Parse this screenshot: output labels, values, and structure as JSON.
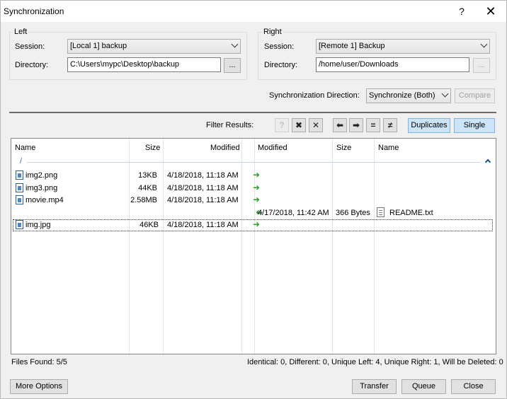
{
  "window": {
    "title": "Synchronization",
    "help_glyph": "?",
    "close_glyph": "✕"
  },
  "left": {
    "group_label": "Left",
    "session_label": "Session:",
    "session_value": "[Local 1] backup",
    "directory_label": "Directory:",
    "directory_value": "C:\\Users\\mypc\\Desktop\\backup",
    "browse_label": "..."
  },
  "right": {
    "group_label": "Right",
    "session_label": "Session:",
    "session_value": "[Remote 1] Backup",
    "directory_label": "Directory:",
    "directory_value": "/home/user/Downloads",
    "browse_label": "..."
  },
  "sync": {
    "direction_label": "Synchronization Direction:",
    "direction_value": "Synchronize (Both)",
    "compare_label": "Compare"
  },
  "filter": {
    "label": "Filter Results:",
    "buttons": [
      {
        "name": "filter-unknown-icon",
        "glyph": "?"
      },
      {
        "name": "filter-conflict-icon",
        "glyph": "✖"
      },
      {
        "name": "filter-delete-icon",
        "glyph": "✕"
      },
      {
        "name": "filter-left-arrow-icon",
        "glyph": "⬅"
      },
      {
        "name": "filter-right-arrow-icon",
        "glyph": "➡"
      },
      {
        "name": "filter-equal-icon",
        "glyph": "="
      },
      {
        "name": "filter-different-icon",
        "glyph": "≠"
      }
    ],
    "duplicates_label": "Duplicates",
    "single_label": "Single"
  },
  "table": {
    "headers": {
      "left_name": "Name",
      "left_size": "Size",
      "left_modified": "Modified",
      "right_modified": "Modified",
      "right_size": "Size",
      "right_name": "Name"
    },
    "path": "/",
    "rows": [
      {
        "left_name": "img2.png",
        "left_size": "13KB",
        "left_modified": "4/18/2018, 11:18 AM",
        "direction": "right",
        "right_modified": "",
        "right_size": "",
        "right_name": ""
      },
      {
        "left_name": "img3.png",
        "left_size": "44KB",
        "left_modified": "4/18/2018, 11:18 AM",
        "direction": "right",
        "right_modified": "",
        "right_size": "",
        "right_name": ""
      },
      {
        "left_name": "movie.mp4",
        "left_size": "2.58MB",
        "left_modified": "4/18/2018, 11:18 AM",
        "direction": "right",
        "right_modified": "",
        "right_size": "",
        "right_name": ""
      },
      {
        "left_name": "",
        "left_size": "",
        "left_modified": "",
        "direction": "left",
        "right_modified": "4/17/2018, 11:42 AM",
        "right_size": "366 Bytes",
        "right_name": "README.txt"
      },
      {
        "left_name": "img.jpg",
        "left_size": "46KB",
        "left_modified": "4/18/2018, 11:18 AM",
        "direction": "right",
        "right_modified": "",
        "right_size": "",
        "right_name": ""
      }
    ]
  },
  "status": {
    "files_found": "Files Found: 5/5",
    "summary": "Identical: 0, Different: 0, Unique Left: 4, Unique Right: 1, Will be Deleted: 0"
  },
  "footer": {
    "more_options_label": "More Options",
    "transfer_label": "Transfer",
    "queue_label": "Queue",
    "close_label": "Close"
  },
  "colors": {
    "accent": "#cce4f7",
    "arrow": "#2e9e2e"
  }
}
